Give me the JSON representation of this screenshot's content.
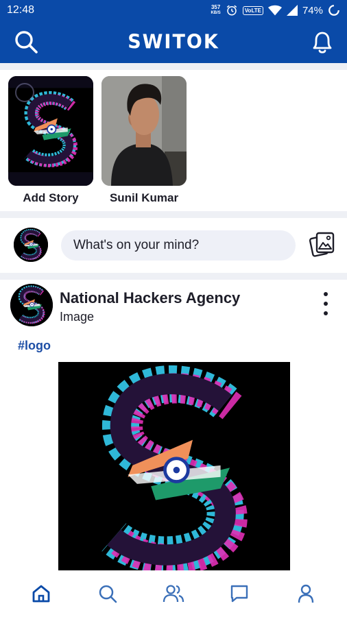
{
  "status_bar": {
    "time": "12:48",
    "speed_value": "357",
    "speed_unit": "KB/S",
    "volte": "VoLTE",
    "battery": "74%"
  },
  "app_bar": {
    "title": "SWITOK",
    "left_icon": "search-icon",
    "right_icon": "bell-icon"
  },
  "stories": [
    {
      "label": "Add Story"
    },
    {
      "label": "Sunil Kumar"
    }
  ],
  "composer": {
    "prompt": "What's on your mind?",
    "icon": "photo-gallery-icon"
  },
  "post": {
    "author": "National Hackers Agency",
    "type": "Image",
    "hashtag": "#logo",
    "more_icon": "more-vertical-icon"
  },
  "bottom_nav": [
    {
      "icon": "home-icon",
      "active": true
    },
    {
      "icon": "search-icon",
      "active": false
    },
    {
      "icon": "friends-icon",
      "active": false
    },
    {
      "icon": "chat-icon",
      "active": false
    },
    {
      "icon": "profile-icon",
      "active": false
    }
  ],
  "colors": {
    "brand": "#0a4aa8",
    "hashtag": "#1e4fa6",
    "logo_cyan": "#2fb8d8",
    "logo_magenta": "#e02fb5",
    "logo_saffron": "#f0905a",
    "logo_green": "#1e9a6a"
  }
}
